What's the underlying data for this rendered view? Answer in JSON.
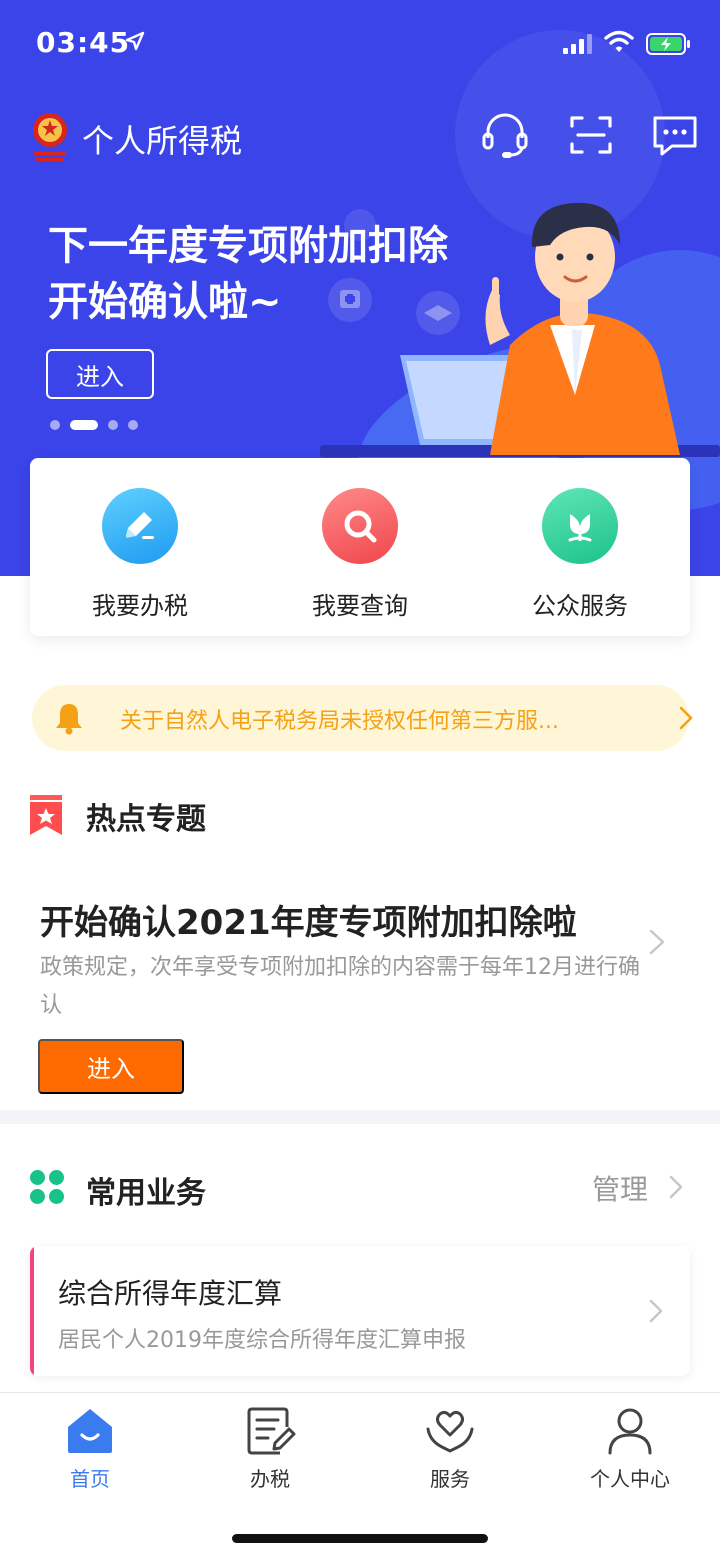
{
  "status_bar": {
    "time": "03:45",
    "icons": [
      "location-arrow-icon",
      "signal-icon",
      "wifi-icon",
      "battery-charging-icon"
    ]
  },
  "header": {
    "app_title": "个人所得税",
    "icons": [
      "emblem-icon",
      "customer-service-icon",
      "scan-icon",
      "message-icon"
    ]
  },
  "banner": {
    "line1": "下一年度专项附加扣除",
    "line2": "开始确认啦~",
    "button": "进入",
    "page_count": 4,
    "active_page": 2
  },
  "quick_actions": [
    {
      "label": "我要办税",
      "icon": "edit-icon",
      "color": "#1e9af0"
    },
    {
      "label": "我要查询",
      "icon": "search-icon",
      "color": "#f0454a"
    },
    {
      "label": "公众服务",
      "icon": "tulip-icon",
      "color": "#1cc28a"
    }
  ],
  "notice": {
    "text": "关于自然人电子税务局未授权任何第三方服...",
    "icon": "bell-icon"
  },
  "hot_topics": {
    "title": "热点专题",
    "topic": {
      "title": "开始确认2021年度专项附加扣除啦",
      "description": "政策规定，次年享受专项附加扣除的内容需于每年12月进行确认",
      "button": "进入"
    }
  },
  "common_services": {
    "title": "常用业务",
    "manage": "管理",
    "items": [
      {
        "name": "综合所得年度汇算",
        "description": "居民个人2019年度综合所得年度汇算申报"
      }
    ]
  },
  "tab_bar": {
    "tabs": [
      {
        "label": "首页",
        "icon": "home-icon",
        "active": true
      },
      {
        "label": "办税",
        "icon": "document-edit-icon",
        "active": false
      },
      {
        "label": "服务",
        "icon": "heart-hands-icon",
        "active": false
      },
      {
        "label": "个人中心",
        "icon": "user-icon",
        "active": false
      }
    ]
  },
  "colors": {
    "brand_blue": "#3a44e8",
    "accent_orange": "#ff6a00",
    "notice_text": "#f5a116",
    "tab_active": "#3a7bf0"
  }
}
